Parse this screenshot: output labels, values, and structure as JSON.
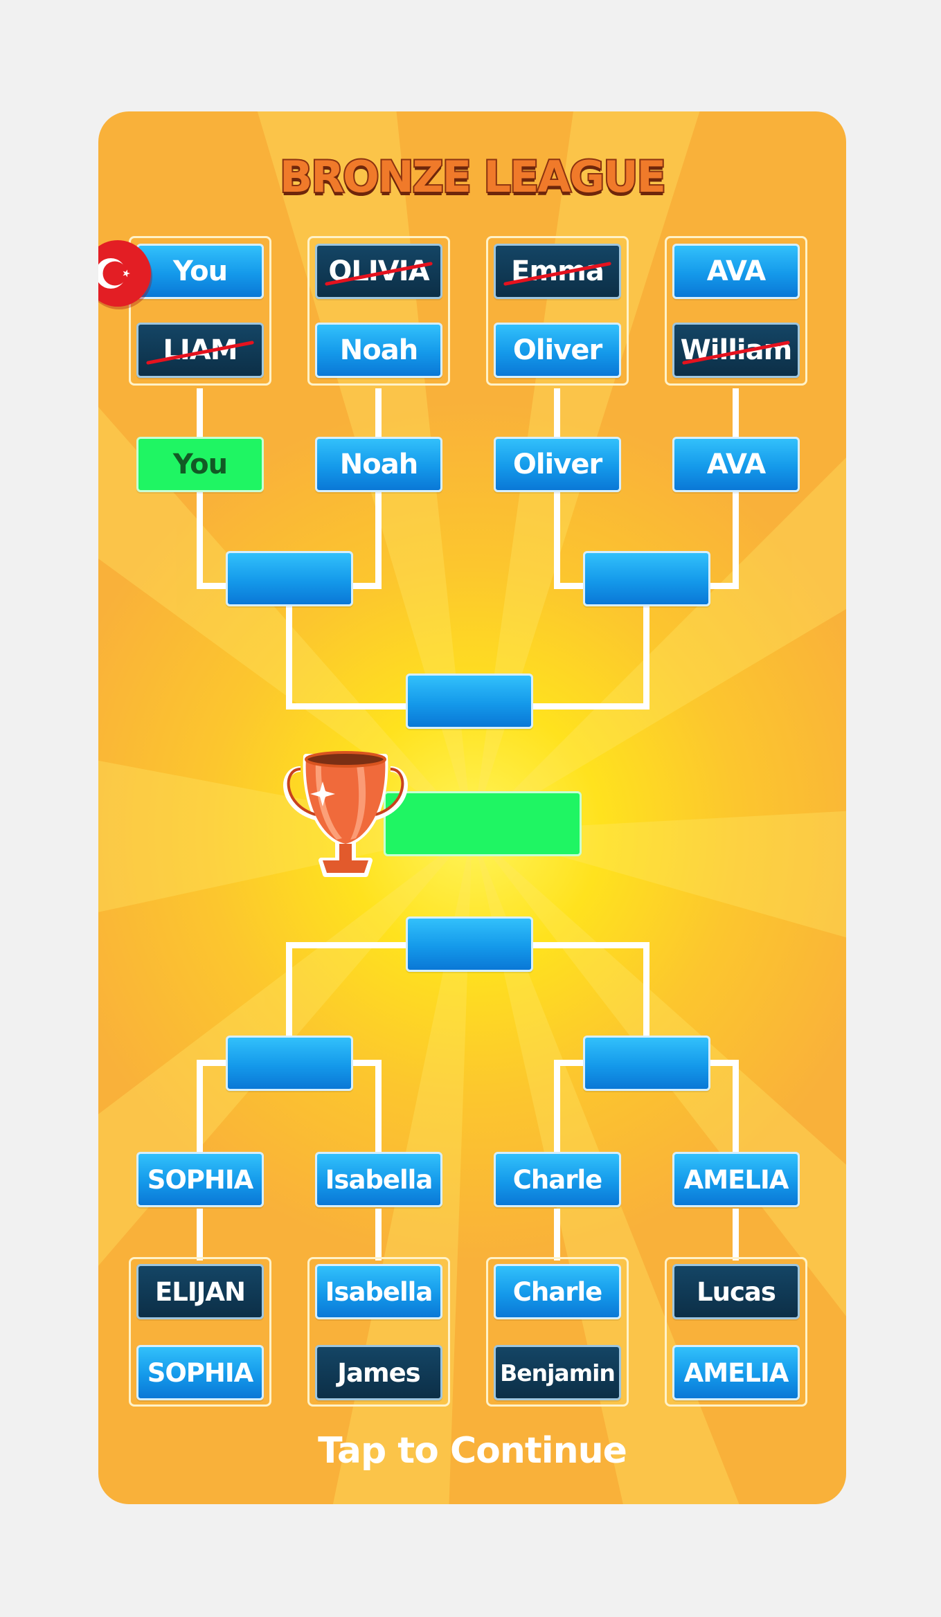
{
  "title": "BRONZE LEAGUE",
  "continue_label": "Tap to Continue",
  "colors": {
    "card": "#f9b13a",
    "slot_blue": "#1499ea",
    "slot_dark": "#0c2f47",
    "slot_green": "#1ff563",
    "title": "#f07a2a"
  },
  "icons": {
    "flag": "turkey-flag-icon",
    "trophy": "bronze-trophy-icon"
  },
  "top_groups": [
    {
      "player_a": "You",
      "player_b": "LIAM",
      "a_eliminated": false,
      "b_eliminated": true
    },
    {
      "player_a": "OLIVIA",
      "player_b": "Noah",
      "a_eliminated": true,
      "b_eliminated": false
    },
    {
      "player_a": "Emma",
      "player_b": "Oliver",
      "a_eliminated": true,
      "b_eliminated": false
    },
    {
      "player_a": "AVA",
      "player_b": "William",
      "a_eliminated": false,
      "b_eliminated": true
    }
  ],
  "top_round2": [
    "You",
    "Noah",
    "Oliver",
    "AVA"
  ],
  "bottom_round2": [
    "SOPHIA",
    "Isabella",
    "Charle",
    "AMELIA"
  ],
  "bottom_groups": [
    {
      "player_a": "ELIJAN",
      "player_b": "SOPHIA"
    },
    {
      "player_a": "Isabella",
      "player_b": "James"
    },
    {
      "player_a": "Charle",
      "player_b": "Benjamin"
    },
    {
      "player_a": "Lucas",
      "player_b": "AMELIA"
    }
  ],
  "semis": [
    "",
    "",
    "",
    ""
  ],
  "finals": [
    "",
    ""
  ],
  "champion": ""
}
